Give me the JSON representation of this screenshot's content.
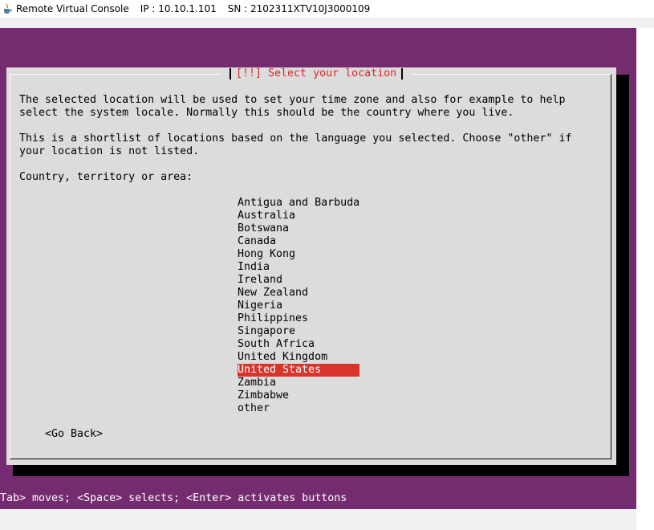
{
  "window": {
    "app_title": "Remote Virtual Console",
    "ip": "IP : 10.10.1.101",
    "sn": "SN : 2102311XTV10J3000109"
  },
  "dialog": {
    "title": "[!!] Select your location",
    "paragraph1": "The selected location will be used to set your time zone and also for example to help\nselect the system locale. Normally this should be the country where you live.",
    "paragraph2": "This is a shortlist of locations based on the language you selected. Choose \"other\" if\nyour location is not listed.",
    "prompt": "Country, territory or area:",
    "countries": [
      "Antigua and Barbuda",
      "Australia",
      "Botswana",
      "Canada",
      "Hong Kong",
      "India",
      "Ireland",
      "New Zealand",
      "Nigeria",
      "Philippines",
      "Singapore",
      "South Africa",
      "United Kingdom",
      "United States",
      "Zambia",
      "Zimbabwe",
      "other"
    ],
    "selected_country": "United States",
    "go_back_label": "<Go Back>"
  },
  "status_line": "Tab> moves; <Space> selects; <Enter> activates buttons",
  "colors": {
    "console_background": "#752b6f",
    "dialog_background": "#dcdcdc",
    "title_color": "#d8282a",
    "selection_background": "#d8362d"
  },
  "icons": {
    "app_icon": "java-coffee-cup-icon"
  }
}
